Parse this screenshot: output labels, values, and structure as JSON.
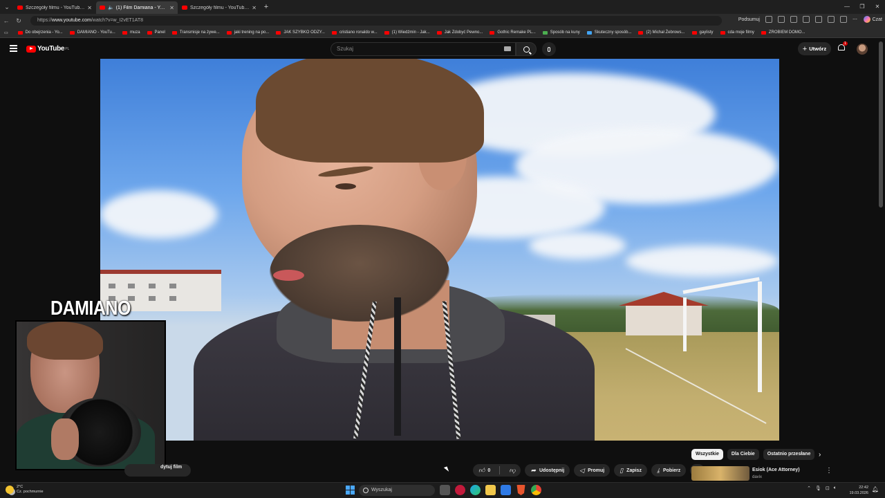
{
  "browser": {
    "tabs": [
      {
        "title": "Szczegóły filmu - YouTube Studio",
        "active": false
      },
      {
        "title": "(1) Film Damiana - YouTube",
        "active": true,
        "audio": true
      },
      {
        "title": "Szczegóły filmu - YouTube Studio",
        "active": false
      }
    ],
    "url_prefix": "https://",
    "url_domain": "www.youtube.com",
    "url_path": "/watch?v=w_I2vET1AT8",
    "summarize_label": "Podsumuj",
    "copilot_label": "Czat",
    "bookmarks": [
      {
        "label": "Do obejrzenia - Yo...",
        "color": "#ff0000"
      },
      {
        "label": "DAMIANO - YouTu...",
        "color": "#ff0000"
      },
      {
        "label": "muza",
        "color": "#ff0000"
      },
      {
        "label": "Panel",
        "color": "#ff0000"
      },
      {
        "label": "Transmisje na żywe...",
        "color": "#ff0000"
      },
      {
        "label": "jaki trening na po...",
        "color": "#ff0000"
      },
      {
        "label": "JAK SZYBKO ODZY...",
        "color": "#ff0000"
      },
      {
        "label": "cristiano ronaldo w...",
        "color": "#ff0000"
      },
      {
        "label": "(1) Wiedźmin - Jak...",
        "color": "#ff0000"
      },
      {
        "label": "Jak Zdobyć Pewno...",
        "color": "#ff0000"
      },
      {
        "label": "Gothic Remake PL...",
        "color": "#ff0000"
      },
      {
        "label": "Sposób na kuny",
        "color": "#4caf50"
      },
      {
        "label": "Skuteczny sposób...",
        "color": "#42a5f5"
      },
      {
        "label": "(2) Michał Żebrows...",
        "color": "#ff0000"
      },
      {
        "label": "gaylisty",
        "color": "#ff0000"
      },
      {
        "label": "cda moje filmy",
        "color": "#ff0000"
      },
      {
        "label": "ZROBIEM DOMO...",
        "color": "#ff0000"
      }
    ]
  },
  "youtube": {
    "logo_text": "YouTube",
    "country_code": "PL",
    "search_placeholder": "Szukaj",
    "create_label": "Utwórz",
    "notification_count": "1",
    "overlay_label": "DAMIANO",
    "edit_label": "dytuj film",
    "like_count": "0",
    "actions": {
      "share": "Udostępnij",
      "promote": "Promuj",
      "save": "Zapisz",
      "download": "Pobierz"
    },
    "chips": [
      "Wszystkie",
      "Dla Ciebie",
      "Ostatnio przesłane"
    ],
    "recommendation": {
      "title": "Esiok (Ace Attorney)",
      "channel": "davix"
    }
  },
  "taskbar": {
    "temperature": "2°C",
    "weather": "Cz. pochmurnie",
    "search_label": "Wyszukaj",
    "time": "22:42",
    "date": "19.03.2026"
  },
  "colors": {
    "accent": "#ff0000",
    "background": "#0f0f0f",
    "chip_bg": "#272727"
  }
}
